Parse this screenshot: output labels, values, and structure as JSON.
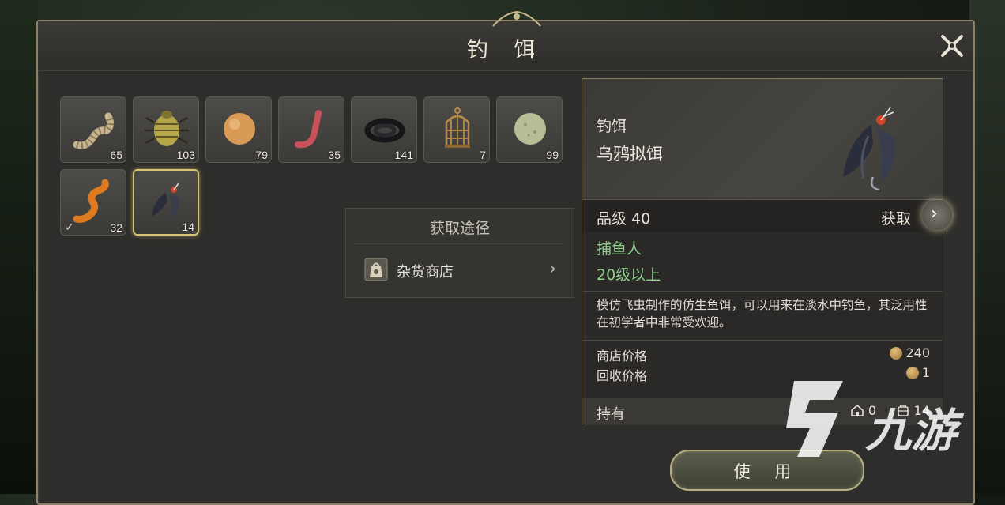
{
  "window": {
    "title": "钓 饵"
  },
  "inventory": {
    "items": [
      {
        "icon": "worm-icon",
        "count": "65",
        "selected": false,
        "equipped": false
      },
      {
        "icon": "beetle-icon",
        "count": "103",
        "selected": false,
        "equipped": false
      },
      {
        "icon": "dough-ball-icon",
        "count": "79",
        "selected": false,
        "equipped": false
      },
      {
        "icon": "red-worm-icon",
        "count": "35",
        "selected": false,
        "equipped": false
      },
      {
        "icon": "black-eel-icon",
        "count": "141",
        "selected": false,
        "equipped": false
      },
      {
        "icon": "cage-icon",
        "count": "7",
        "selected": false,
        "equipped": false
      },
      {
        "icon": "green-ball-icon",
        "count": "99",
        "selected": false,
        "equipped": false
      },
      {
        "icon": "orange-worm-icon",
        "count": "32",
        "selected": false,
        "equipped": true,
        "check": "✓"
      },
      {
        "icon": "crow-fly-icon",
        "count": "14",
        "selected": true,
        "equipped": false
      }
    ]
  },
  "acquisition": {
    "title": "获取途径",
    "source_label": "杂货商店",
    "chevron": "›"
  },
  "detail": {
    "category": "钓饵",
    "name": "乌鸦拟饵",
    "grade": "品级 40",
    "get_label": "获取",
    "get_chevron": "›",
    "requirement_job": "捕鱼人",
    "requirement_level": "20级以上",
    "description": "模仿飞虫制作的仿生鱼饵，可以用来在淡水中钓鱼，其泛用性在初学者中非常受欢迎。",
    "shop_price_label": "商店价格",
    "shop_price_value": "240",
    "recycle_price_label": "回收价格",
    "recycle_price_value": "1",
    "hold_label": "持有",
    "hold_storage": "0",
    "hold_bag": "14"
  },
  "actions": {
    "use_label": "使 用"
  },
  "watermark": {
    "logo_text": "九游"
  },
  "colors": {
    "accent_gold": "#d6c47a",
    "req_green": "#8fcf8c",
    "panel_bg": "#2d2d2b"
  }
}
